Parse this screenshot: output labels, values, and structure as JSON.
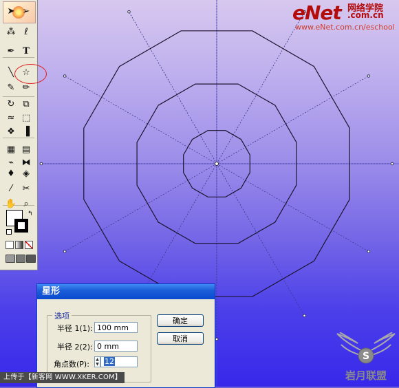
{
  "watermark": {
    "brand": "eNet",
    "brand_cn": "网络学院",
    "domain": ".com.cn",
    "url": "www.eNet.com.cn/eschool",
    "color": "#b40b0b"
  },
  "canvas": {
    "gradient_top": "#d7c8ef",
    "gradient_bottom": "#3728ea",
    "polygon_sides": 12
  },
  "toolbox": {
    "tools": [
      "selection-icon",
      "direct-selection-icon",
      "magic-wand-icon",
      "lasso-icon",
      "pen-icon",
      "type-icon",
      "line-segment-icon",
      "star-icon",
      "paintbrush-icon",
      "pencil-icon",
      "rotate-icon",
      "scale-icon",
      "warp-icon",
      "free-transform-icon",
      "symbol-sprayer-icon",
      "column-graph-icon",
      "mesh-icon",
      "gradient-icon",
      "eyedropper-icon",
      "blend-icon",
      "live-paint-bucket-icon",
      "live-paint-selection-icon",
      "slice-icon",
      "scissors-icon",
      "hand-icon",
      "zoom-icon"
    ],
    "highlighted_tool": "star-icon",
    "highlight_color": "#e02020"
  },
  "dialog": {
    "title": "星形",
    "group_label": "选项",
    "radius1_label": "半径 1(1):",
    "radius1_value": "100 mm",
    "radius2_label": "半径 2(2):",
    "radius2_value": "0 mm",
    "points_label": "角点数(P):",
    "points_value": "12",
    "ok_label": "确定",
    "cancel_label": "取消"
  },
  "caption": "上传于【新客网 WWW.XKER.COM】",
  "logo": {
    "text": "岩月联盟",
    "letter": "S"
  }
}
